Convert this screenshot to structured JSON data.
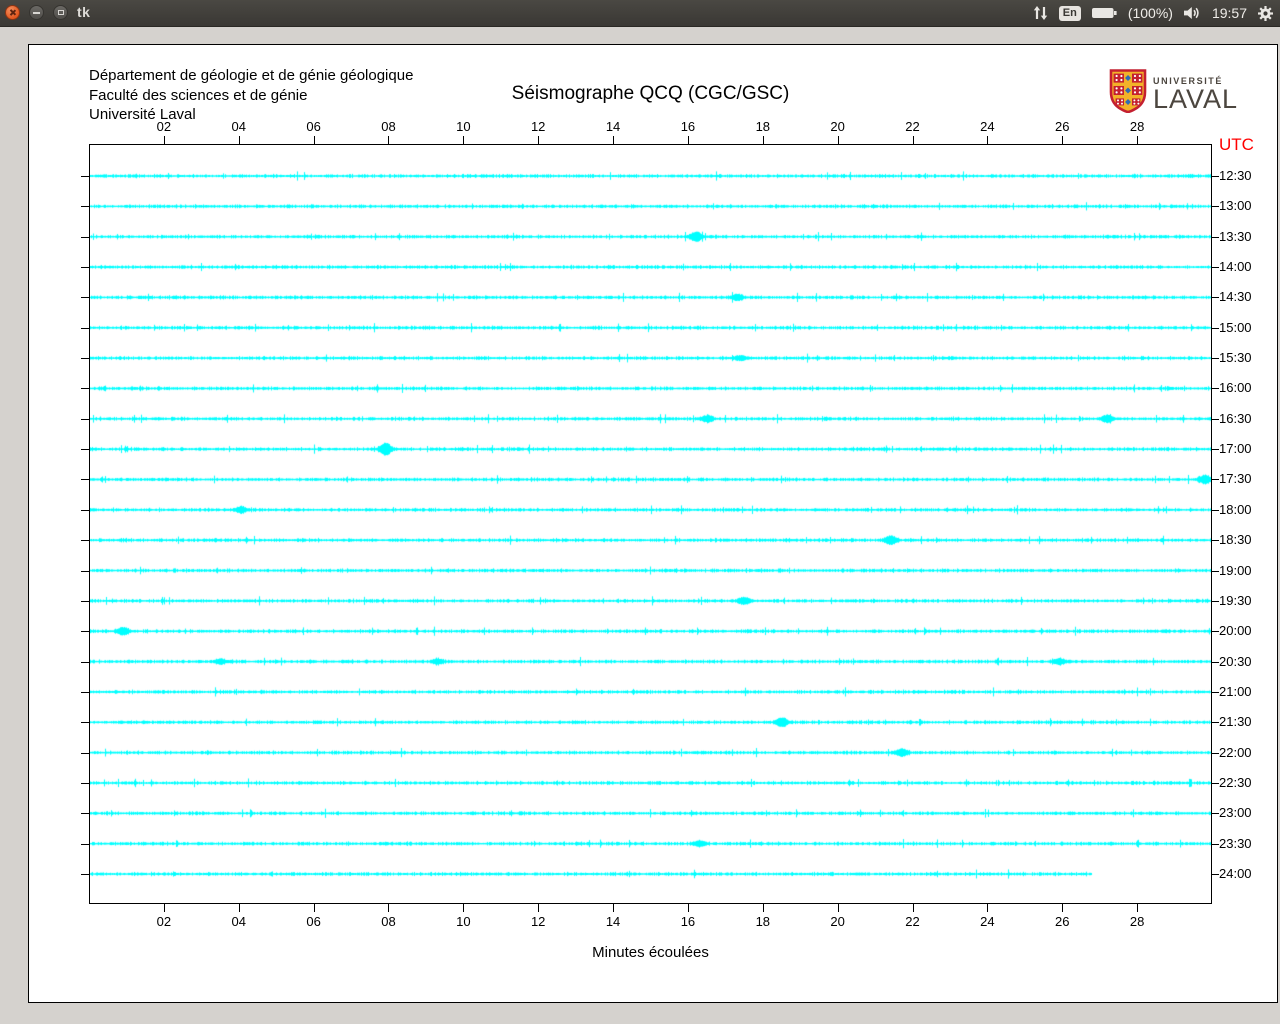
{
  "titlebar": {
    "title": "tk",
    "tray": {
      "keyboard_layout": "En",
      "battery_label": "(100%)",
      "clock": "19:57"
    }
  },
  "app": {
    "header_lines": [
      "Département de géologie et de génie géologique",
      "Faculté des sciences et de génie",
      "Université Laval"
    ],
    "title": "Séismographe QCQ (CGC/GSC)",
    "logo": {
      "top": "UNIVERSITÉ",
      "bottom": "LAVAL"
    }
  },
  "chart_data": {
    "type": "line",
    "variant": "helicorder-seismograph",
    "title": "Séismographe QCQ (CGC/GSC)",
    "xlabel": "Minutes écoulées",
    "right_axis_title": "UTC",
    "right_axis_title_color": "#ff0000",
    "trace_color": "#00ffff",
    "x_range_minutes": [
      0,
      30
    ],
    "minutes_per_row": 30,
    "x_tick_labels": [
      "02",
      "04",
      "06",
      "08",
      "10",
      "12",
      "14",
      "16",
      "18",
      "20",
      "22",
      "24",
      "26",
      "28"
    ],
    "rows": [
      {
        "utc": "12:30",
        "end_minute": 30
      },
      {
        "utc": "13:00",
        "end_minute": 30
      },
      {
        "utc": "13:30",
        "end_minute": 30
      },
      {
        "utc": "14:00",
        "end_minute": 30
      },
      {
        "utc": "14:30",
        "end_minute": 30
      },
      {
        "utc": "15:00",
        "end_minute": 30
      },
      {
        "utc": "15:30",
        "end_minute": 30
      },
      {
        "utc": "16:00",
        "end_minute": 30
      },
      {
        "utc": "16:30",
        "end_minute": 30
      },
      {
        "utc": "17:00",
        "end_minute": 30
      },
      {
        "utc": "17:30",
        "end_minute": 30
      },
      {
        "utc": "18:00",
        "end_minute": 30
      },
      {
        "utc": "18:30",
        "end_minute": 30
      },
      {
        "utc": "19:00",
        "end_minute": 30
      },
      {
        "utc": "19:30",
        "end_minute": 30
      },
      {
        "utc": "20:00",
        "end_minute": 30
      },
      {
        "utc": "20:30",
        "end_minute": 30
      },
      {
        "utc": "21:00",
        "end_minute": 30
      },
      {
        "utc": "21:30",
        "end_minute": 30
      },
      {
        "utc": "22:00",
        "end_minute": 30
      },
      {
        "utc": "22:30",
        "end_minute": 30
      },
      {
        "utc": "23:00",
        "end_minute": 30
      },
      {
        "utc": "23:30",
        "end_minute": 30
      },
      {
        "utc": "24:00",
        "end_minute": 26.8
      }
    ],
    "events": [
      {
        "utc": "13:30",
        "minute": 16.2,
        "amplitude": 4
      },
      {
        "utc": "14:30",
        "minute": 17.3,
        "amplitude": 2.5
      },
      {
        "utc": "15:30",
        "minute": 17.4,
        "amplitude": 2
      },
      {
        "utc": "16:30",
        "minute": 16.5,
        "amplitude": 2.5
      },
      {
        "utc": "16:30",
        "minute": 27.2,
        "amplitude": 3
      },
      {
        "utc": "17:00",
        "minute": 7.9,
        "amplitude": 5
      },
      {
        "utc": "17:30",
        "minute": 29.8,
        "amplitude": 3.5
      },
      {
        "utc": "18:00",
        "minute": 4.05,
        "amplitude": 2.5
      },
      {
        "utc": "18:30",
        "minute": 21.4,
        "amplitude": 3.5
      },
      {
        "utc": "19:30",
        "minute": 17.5,
        "amplitude": 3
      },
      {
        "utc": "20:00",
        "minute": 0.9,
        "amplitude": 3
      },
      {
        "utc": "20:30",
        "minute": 3.5,
        "amplitude": 2
      },
      {
        "utc": "20:30",
        "minute": 9.3,
        "amplitude": 2
      },
      {
        "utc": "20:30",
        "minute": 25.9,
        "amplitude": 2.5
      },
      {
        "utc": "21:30",
        "minute": 18.5,
        "amplitude": 3.5
      },
      {
        "utc": "22:00",
        "minute": 21.7,
        "amplitude": 3
      },
      {
        "utc": "23:30",
        "minute": 16.3,
        "amplitude": 2.5
      }
    ]
  }
}
